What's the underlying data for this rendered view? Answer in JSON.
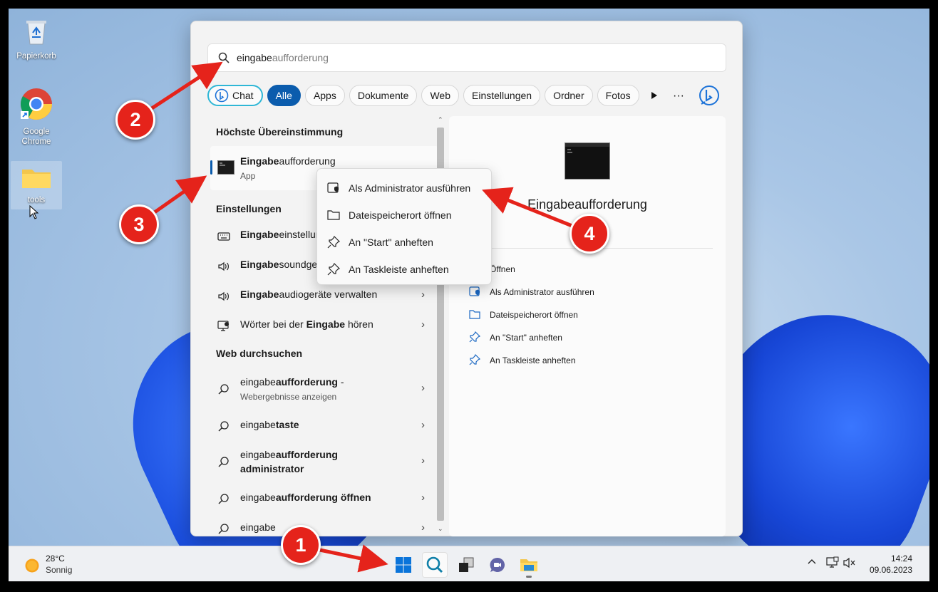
{
  "desktop": {
    "icons": [
      {
        "label": "Papierkorb"
      },
      {
        "label": "Google Chrome"
      },
      {
        "label": "tools"
      }
    ]
  },
  "search": {
    "typed": "eingabe",
    "completion": "aufforderung"
  },
  "filters": {
    "chat": "Chat",
    "items": [
      "Alle",
      "Apps",
      "Dokumente",
      "Web",
      "Einstellungen",
      "Ordner",
      "Fotos"
    ],
    "more": "···"
  },
  "results": {
    "best_match_title": "Höchste Übereinstimmung",
    "best_match": {
      "bold": "Eingabe",
      "rest": "aufforderung",
      "type": "App"
    },
    "settings_title": "Einstellungen",
    "settings": [
      {
        "bold": "Eingabe",
        "rest": "einstellungen"
      },
      {
        "bold": "Eingabe",
        "rest": "soundgeräte verwalten"
      },
      {
        "bold": "Eingabe",
        "rest": "audiogeräte verwalten"
      },
      {
        "pre": "Wörter bei der ",
        "bold": "Eingabe",
        "rest": " hören"
      }
    ],
    "web_title": "Web durchsuchen",
    "web": [
      {
        "pre": "eingabe",
        "bold": "aufforderung",
        "rest": " -",
        "sub": "Webergebnisse anzeigen"
      },
      {
        "pre": "eingabe",
        "bold": "taste",
        "rest": ""
      },
      {
        "pre": "eingabe",
        "bold": "aufforderung",
        "rest": "",
        "line2": "administrator"
      },
      {
        "pre": "eingabe",
        "bold": "aufforderung öffnen",
        "rest": ""
      },
      {
        "pre": "eingabe",
        "bold": "",
        "rest": ""
      }
    ]
  },
  "detail": {
    "title": "Eingabeaufforderung",
    "actions": [
      "Öffnen",
      "Als Administrator ausführen",
      "Dateispeicherort öffnen",
      "An \"Start\" anheften",
      "An Taskleiste anheften"
    ]
  },
  "context_menu": {
    "items": [
      "Als Administrator ausführen",
      "Dateispeicherort öffnen",
      "An \"Start\" anheften",
      "An Taskleiste anheften"
    ]
  },
  "taskbar": {
    "weather_temp": "28°C",
    "weather_cond": "Sonnig",
    "time": "14:24",
    "date": "09.06.2023"
  },
  "annotations": [
    "1",
    "2",
    "3",
    "4"
  ],
  "colors": {
    "accent": "#0b5cad",
    "annotation": "#e5231b"
  }
}
